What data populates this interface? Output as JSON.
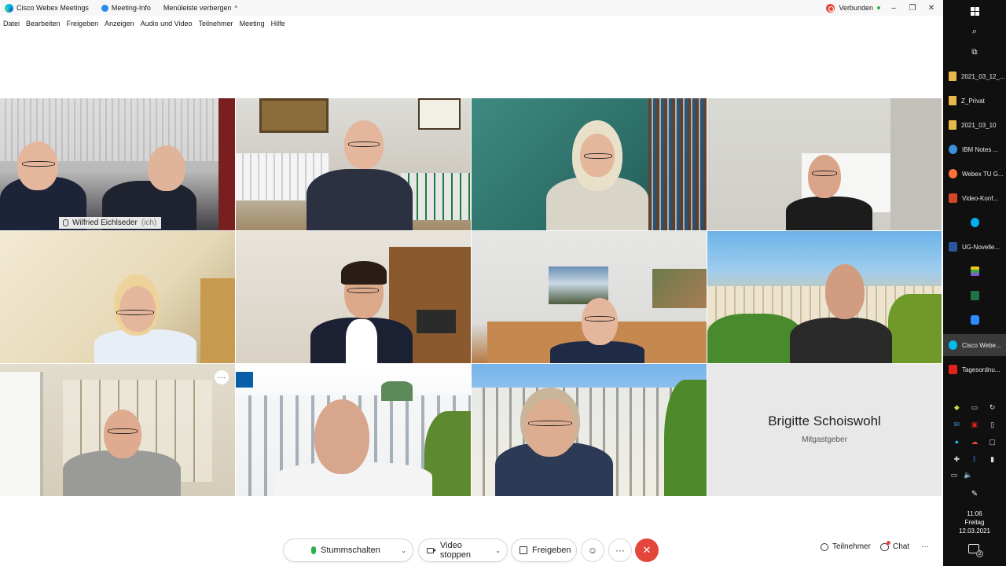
{
  "titlebar": {
    "app_name": "Cisco Webex Meetings",
    "meeting_info": "Meeting-Info",
    "hide_menu": "Menüleiste verbergen",
    "status": "Verbunden"
  },
  "menu": [
    "Datei",
    "Bearbeiten",
    "Freigeben",
    "Anzeigen",
    "Audio und Video",
    "Teilnehmer",
    "Meeting",
    "Hilfe"
  ],
  "self_tile": {
    "name": "Wilfried Eichlseder",
    "suffix": "(ich)"
  },
  "empty_tile": {
    "name": "Brigitte Schoiswohl",
    "role": "Mitgastgeber"
  },
  "tile_more_button": "···",
  "controls": {
    "mute": "Stummschalten",
    "stop_video": "Video stoppen",
    "share": "Freigeben",
    "reactions_icon": "smiley-icon",
    "more": "···",
    "end_icon": "close-icon",
    "participants": "Teilnehmer",
    "chat": "Chat",
    "more_right": "···"
  },
  "taskbar": {
    "apps": [
      {
        "label": "2021_03_12_...",
        "icon": "folder-icon",
        "color": "#e8b84a"
      },
      {
        "label": "Z_Privat",
        "icon": "folder-icon",
        "color": "#e8b84a"
      },
      {
        "label": "2021_03_10",
        "icon": "folder-icon",
        "color": "#e8b84a"
      },
      {
        "label": "IBM Notes ...",
        "icon": "ibm-notes-icon",
        "color": "#3b8fd6"
      },
      {
        "label": "Webex TU G...",
        "icon": "firefox-icon",
        "color": "#ff7139"
      },
      {
        "label": "Video-Konf...",
        "icon": "powerpoint-icon",
        "color": "#d24726"
      },
      {
        "label": "",
        "icon": "skype-icon",
        "color": "#00aff0"
      },
      {
        "label": "UG-Novelle...",
        "icon": "word-icon",
        "color": "#2b579a"
      },
      {
        "label": "",
        "icon": "tiles-icon",
        "color": "#f2c811"
      },
      {
        "label": "",
        "icon": "excel-icon",
        "color": "#217346"
      },
      {
        "label": "",
        "icon": "zoom-icon",
        "color": "#2d8cff"
      },
      {
        "label": "Cisco Webe...",
        "icon": "webex-icon",
        "color": "#00bceb"
      },
      {
        "label": "Tagesordnu...",
        "icon": "pdf-icon",
        "color": "#e2231a"
      }
    ],
    "clock_time": "11:06",
    "clock_day": "Freitag",
    "clock_date": "12.03.2021",
    "notif_count": "2"
  }
}
